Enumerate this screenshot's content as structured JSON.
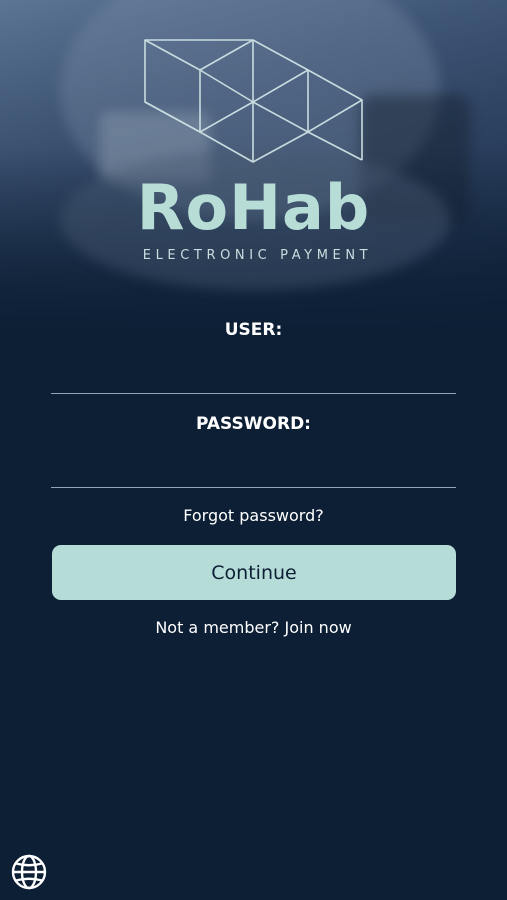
{
  "brand": {
    "name": "RoHab",
    "tagline": "ELECTRONIC PAYMENT"
  },
  "form": {
    "user_label": "USER:",
    "user_value": "",
    "password_label": "PASSWORD:",
    "password_value": "",
    "forgot_password": "Forgot password?",
    "continue_label": "Continue",
    "join_text": "Not a member? Join now"
  },
  "footer": {
    "language_icon": "globe-icon"
  },
  "colors": {
    "background": "#0d1f35",
    "accent": "#b6dcd8",
    "logo": "#b8ddd7"
  }
}
